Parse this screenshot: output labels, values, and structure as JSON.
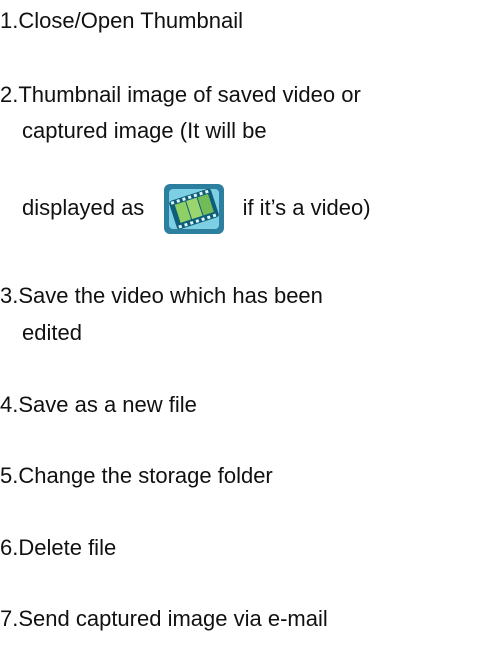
{
  "items": [
    {
      "number": "1.",
      "text": "Close/Open Thumbnail"
    },
    {
      "number": "2.",
      "text_line1": "Thumbnail image of saved video or",
      "text_line2": "captured image (It will be",
      "text_line3_before": "displayed as",
      "icon_name": "video-film-icon",
      "text_line3_after": "if it’s a video)"
    },
    {
      "number": "3.",
      "text_line1": "Save the video which has been",
      "text_line2": "edited"
    },
    {
      "number": "4.",
      "text": "Save as a new file"
    },
    {
      "number": "5.",
      "text": "Change the storage folder"
    },
    {
      "number": "6.",
      "text": "Delete file"
    },
    {
      "number": "7.",
      "text": "Send captured image via e-mail"
    }
  ],
  "colors": {
    "text": "#111111",
    "icon_background": "#2c7f9e",
    "icon_frame": "#7dcfe3",
    "icon_film": "#8ecf66"
  }
}
